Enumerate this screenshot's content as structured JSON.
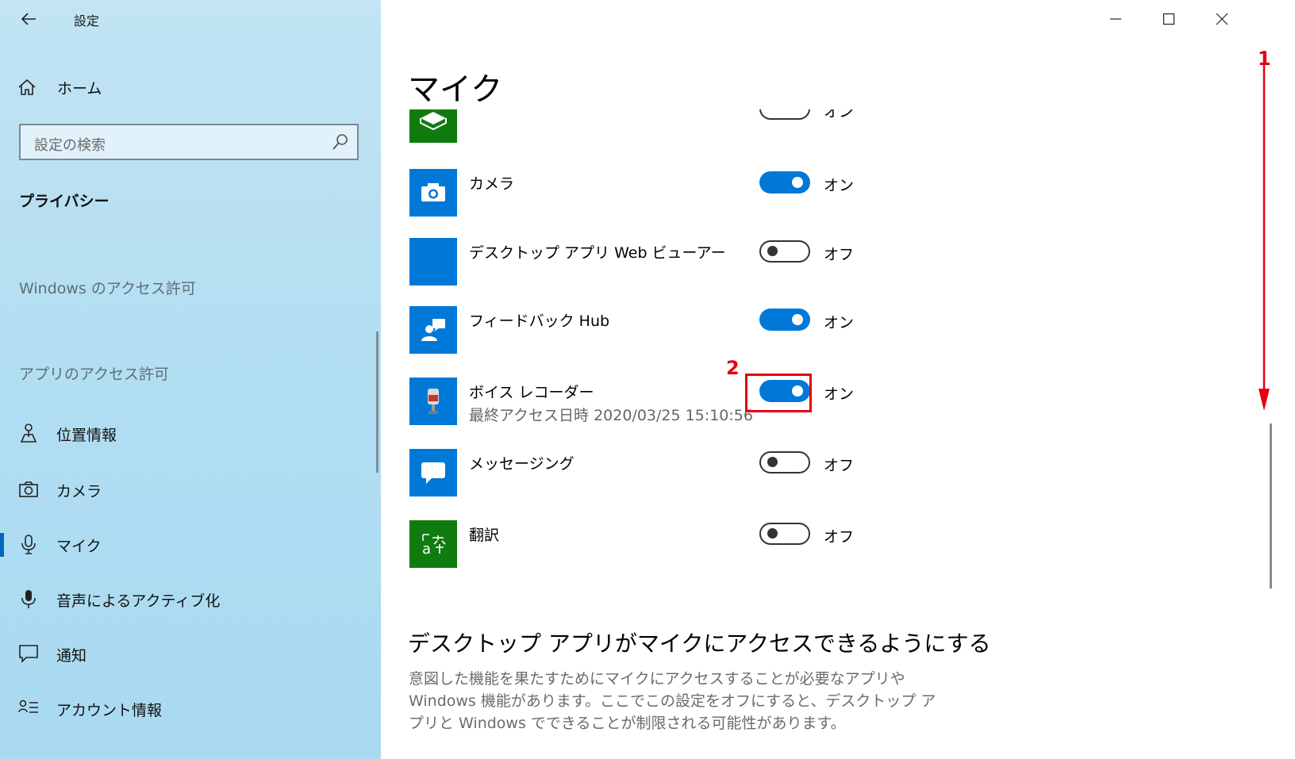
{
  "window": {
    "title": "設定",
    "minimize_icon": "minimize-icon",
    "maximize_icon": "maximize-icon",
    "close_icon": "close-icon"
  },
  "sidebar": {
    "home_label": "ホーム",
    "search_placeholder": "設定の検索",
    "section_title": "プライバシー",
    "group1_header": "Windows のアクセス許可",
    "group2_header": "アプリのアクセス許可",
    "items": [
      {
        "label": "位置情報",
        "icon": "location-icon"
      },
      {
        "label": "カメラ",
        "icon": "camera-icon"
      },
      {
        "label": "マイク",
        "icon": "microphone-icon",
        "active": true
      },
      {
        "label": "音声によるアクティブ化",
        "icon": "voice-activation-icon"
      },
      {
        "label": "通知",
        "icon": "notification-icon"
      },
      {
        "label": "アカウント情報",
        "icon": "account-info-icon"
      }
    ]
  },
  "main": {
    "page_title": "マイク",
    "apps": [
      {
        "name": "",
        "state": "オン",
        "on": true,
        "tile_color": "#107c10",
        "icon": "clipped-app-icon"
      },
      {
        "name": "カメラ",
        "state": "オン",
        "on": true,
        "tile_color": "#0078d7",
        "icon": "camera-app-icon"
      },
      {
        "name": "デスクトップ アプリ Web ビューアー",
        "state": "オフ",
        "on": false,
        "tile_color": "#0078d7",
        "icon": "web-viewer-icon"
      },
      {
        "name": "フィードバック Hub",
        "state": "オン",
        "on": true,
        "tile_color": "#0078d7",
        "icon": "feedback-hub-icon"
      },
      {
        "name": "ボイス レコーダー",
        "sub": "最終アクセス日時 2020/03/25 15:10:56",
        "state": "オン",
        "on": true,
        "tile_color": "#0078d7",
        "icon": "voice-recorder-icon"
      },
      {
        "name": "メッセージング",
        "state": "オフ",
        "on": false,
        "tile_color": "#0078d7",
        "icon": "messaging-icon"
      },
      {
        "name": "翻訳",
        "state": "オフ",
        "on": false,
        "tile_color": "#107c10",
        "icon": "translator-icon"
      }
    ],
    "section_title": "デスクトップ アプリがマイクにアクセスできるようにする",
    "description": "意図した機能を果たすためにマイクにアクセスすることが必要なアプリや Windows 機能があります。ここでこの設定をオフにすると、デスクトップ アプリと Windows でできることが制限される可能性があります。"
  },
  "annotations": {
    "step1": "1",
    "step2": "2",
    "color": "#e60012"
  }
}
